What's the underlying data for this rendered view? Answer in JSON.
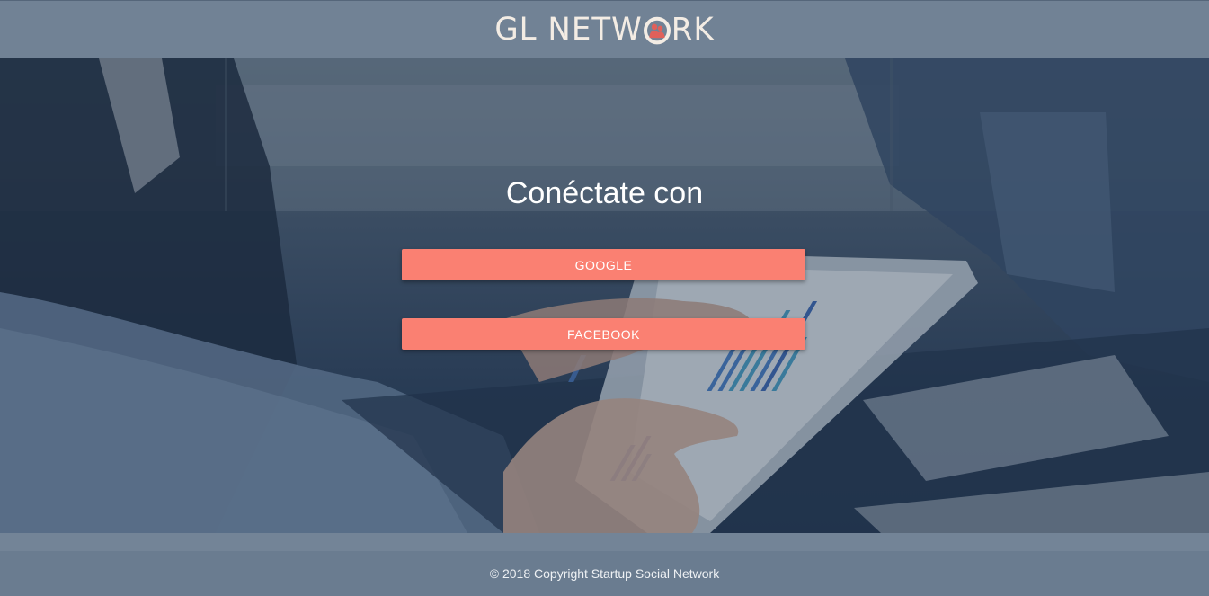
{
  "header": {
    "logo": {
      "prefix": "GL NETW",
      "suffix": "RK",
      "icon": "people-icon",
      "colors": {
        "text": "#f3ece4",
        "icon": "#e0605a"
      }
    }
  },
  "hero": {
    "title": "Conéctate con",
    "buttons": {
      "google": "GOOGLE",
      "facebook": "FACEBOOK"
    },
    "accent_color": "#fa8072"
  },
  "footer": {
    "copyright": "© 2018 Copyright Startup Social Network"
  }
}
